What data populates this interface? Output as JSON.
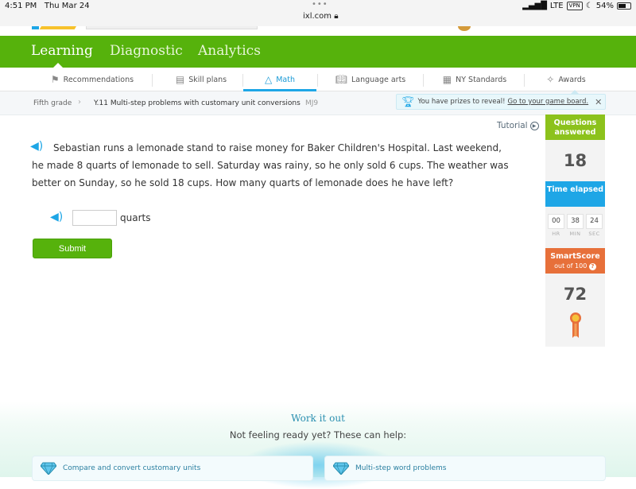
{
  "status_bar": {
    "time": "4:51 PM",
    "date": "Thu Mar 24",
    "url": "ixl.com",
    "signal": "LTE",
    "vpn": "VPN",
    "battery": "54%"
  },
  "top_nav": {
    "items": [
      "Learning",
      "Diagnostic",
      "Analytics"
    ],
    "active": "Learning"
  },
  "subject_tabs": [
    {
      "label": "Recommendations",
      "icon": "signpost-icon"
    },
    {
      "label": "Skill plans",
      "icon": "skill-plan-icon"
    },
    {
      "label": "Math",
      "icon": "pyramid-icon",
      "active": true
    },
    {
      "label": "Language arts",
      "icon": "book-icon"
    },
    {
      "label": "NY Standards",
      "icon": "clipboard-icon"
    },
    {
      "label": "Awards",
      "icon": "confetti-icon"
    }
  ],
  "breadcrumb": {
    "grade": "Fifth grade",
    "skill": "Y.11 Multi-step problems with customary unit conversions",
    "code": "MJ9"
  },
  "prizes": {
    "text": "You have prizes to reveal!",
    "link": "Go to your game board."
  },
  "question": {
    "text": "Sebastian runs a lemonade stand to raise money for Baker Children's Hospital. Last weekend, he made 8 quarts of lemonade to sell. Saturday was rainy, so he only sold 6 cups. The weather was better on Sunday, so he sold 18 cups. How many quarts of lemonade does he have left?",
    "answer_value": "",
    "unit": "quarts",
    "submit_label": "Submit"
  },
  "tutorial_label": "Tutorial",
  "stats": {
    "questions_label": "Questions answered",
    "questions_value": "18",
    "time_label": "Time elapsed",
    "timer": {
      "hr": "00",
      "min": "38",
      "sec": "24"
    },
    "timer_labels": {
      "hr": "HR",
      "min": "MIN",
      "sec": "SEC"
    },
    "smartscore_label": "SmartScore",
    "smartscore_sub": "out of 100",
    "smartscore_value": "72"
  },
  "work_it_out": {
    "title": "Work it out",
    "subtitle": "Not feeling ready yet? These can help:",
    "cards": [
      "Compare and convert customary units",
      "Multi-step word problems"
    ]
  },
  "colors": {
    "brand_green": "#56b20c",
    "accent_blue": "#1ea6e6",
    "questions_green": "#8cc21c",
    "smartscore_orange": "#e7703a"
  }
}
